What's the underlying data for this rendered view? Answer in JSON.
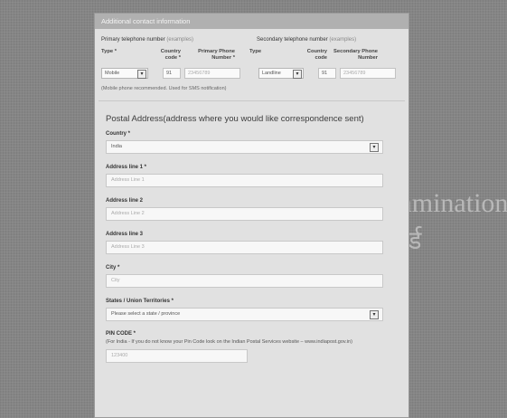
{
  "watermark": {
    "english": "National Board of Examinations",
    "hindi": "राष्ट्रीय परीक्षा बोर्ड"
  },
  "header": {
    "title": "Additional contact information"
  },
  "phones": {
    "primary_label": "Primary telephone number",
    "secondary_label": "Secondary telephone number",
    "examples_link": "(examples)",
    "col_type": "Type *",
    "col_country_code": "Country code *",
    "col_primary_number": "Primary Phone Number *",
    "col_type2": "Type",
    "col_country_code2": "Country code",
    "col_secondary_number": "Secondary Phone Number",
    "primary_type_value": "Mobile",
    "primary_code_value": "91",
    "primary_number_placeholder": "23456789",
    "secondary_type_value": "Landline",
    "secondary_code_value": "91",
    "secondary_number_placeholder": "23456789",
    "note": "(Mobile phone recommended. Used for SMS notification)"
  },
  "postal": {
    "title": "Postal Address(address where you would like correspondence sent)",
    "country_label": "Country *",
    "country_value": "India",
    "address1_label": "Address line 1 *",
    "address1_placeholder": "Address Line 1",
    "address2_label": "Address line 2",
    "address2_placeholder": "Address Line 2",
    "address3_label": "Address line 3",
    "address3_placeholder": "Address Line 3",
    "city_label": "City *",
    "city_placeholder": "City",
    "state_label": "States / Union Territories *",
    "state_value": "Please select a state / province",
    "pin_label": "PIN CODE *",
    "pin_note": "(For India - If you do not know your Pin Code look on the Indian Postal Services website – www.indiapost.gov.in)",
    "pin_placeholder": "123400"
  }
}
